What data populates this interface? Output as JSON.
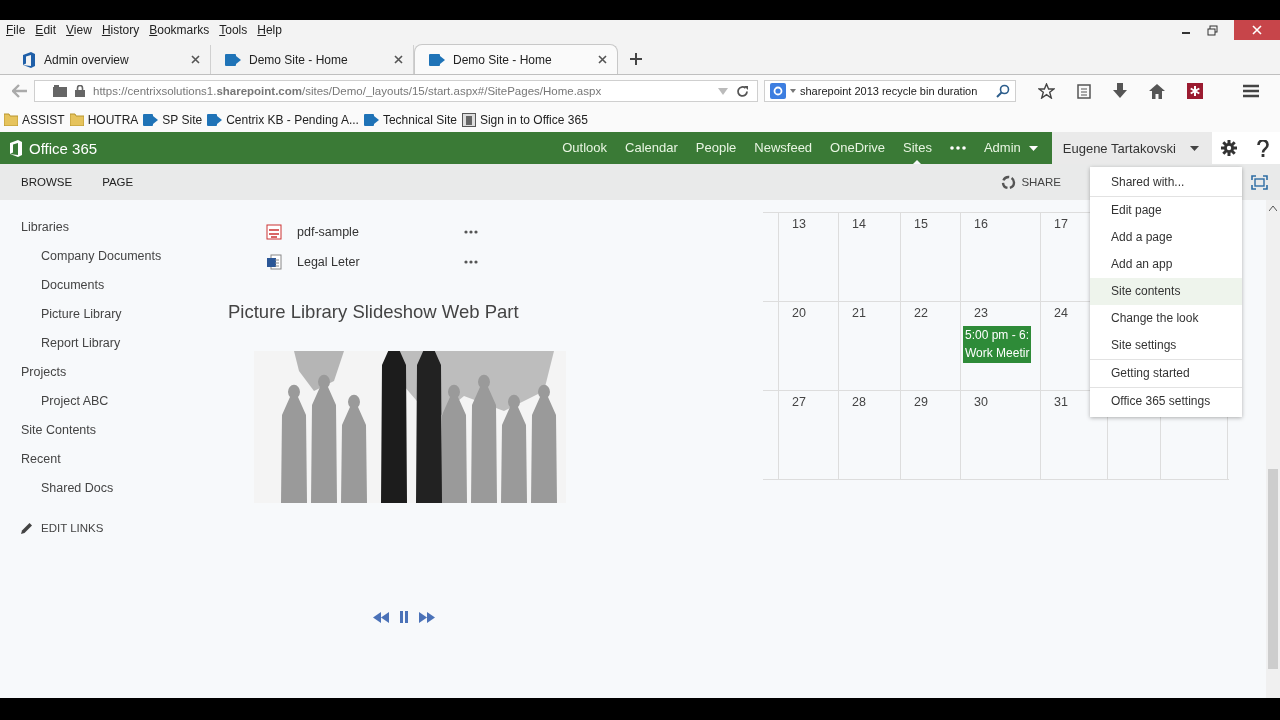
{
  "menu_bar": [
    "File",
    "Edit",
    "View",
    "History",
    "Bookmarks",
    "Tools",
    "Help"
  ],
  "tabs": [
    {
      "label": "Admin overview",
      "kind": "office",
      "selected": false
    },
    {
      "label": "Demo Site - Home",
      "kind": "sharepoint",
      "selected": false
    },
    {
      "label": "Demo Site - Home",
      "kind": "sharepoint",
      "selected": true
    }
  ],
  "address_bar": {
    "url": "https://centrixsolutions1.**sharepoint.com**/sites/Demo/_layouts/15/start.aspx#/SitePages/Home.aspx"
  },
  "search": {
    "value": "sharepoint 2013 recycle bin duration"
  },
  "bookmarks": [
    {
      "label": "ASSIST",
      "kind": "folder"
    },
    {
      "label": "HOUTRA",
      "kind": "folder"
    },
    {
      "label": "SP Site",
      "kind": "sharepoint"
    },
    {
      "label": "Centrix KB - Pending A...",
      "kind": "sharepoint"
    },
    {
      "label": "Technical Site",
      "kind": "sharepoint"
    },
    {
      "label": "Sign in to Office 365",
      "kind": "page"
    }
  ],
  "suite_bar": {
    "brand": "Office 365",
    "links": [
      {
        "label": "Outlook",
        "selected": false
      },
      {
        "label": "Calendar",
        "selected": false
      },
      {
        "label": "People",
        "selected": false
      },
      {
        "label": "Newsfeed",
        "selected": false
      },
      {
        "label": "OneDrive",
        "selected": false
      },
      {
        "label": "Sites",
        "selected": true
      }
    ],
    "admin": "Admin",
    "user": "Eugene Tartakovski"
  },
  "ribbon": {
    "tabs": [
      "BROWSE",
      "PAGE"
    ],
    "share": "SHARE"
  },
  "quick_launch": [
    {
      "label": "Libraries",
      "children": [
        {
          "label": "Company Documents"
        },
        {
          "label": "Documents"
        },
        {
          "label": "Picture Library"
        },
        {
          "label": "Report Library"
        }
      ]
    },
    {
      "label": "Projects",
      "children": [
        {
          "label": "Project ABC"
        }
      ]
    },
    {
      "label": "Site Contents"
    },
    {
      "label": "Recent",
      "children": [
        {
          "label": "Shared Docs"
        }
      ]
    }
  ],
  "edit_links": "EDIT LINKS",
  "documents": [
    {
      "name": "pdf-sample",
      "kind": "pdf"
    },
    {
      "name": "Legal Leter",
      "kind": "word"
    }
  ],
  "slideshow": {
    "title": "Picture Library Slideshow Web Part",
    "kind": "picture"
  },
  "calendar": {
    "weeks": [
      {
        "days": [
          {
            "label": "13"
          },
          {
            "label": "14"
          },
          {
            "label": "15"
          },
          {
            "label": "16"
          },
          {
            "label": "17"
          }
        ]
      },
      {
        "days": [
          {
            "label": "20"
          },
          {
            "label": "21"
          },
          {
            "label": "22"
          },
          {
            "label": "23",
            "events": [
              {
                "time": "5:00 pm - 6:",
                "title": "Work Meetir"
              }
            ]
          },
          {
            "label": "24"
          }
        ]
      },
      {
        "days": [
          {
            "label": "27"
          },
          {
            "label": "28"
          },
          {
            "label": "29"
          },
          {
            "label": "30"
          },
          {
            "label": "31"
          }
        ]
      }
    ]
  },
  "settings_menu": {
    "groups": [
      {
        "items": [
          {
            "label": "Shared with...",
            "selected": false
          }
        ]
      },
      {
        "items": [
          {
            "label": "Edit page",
            "selected": false
          },
          {
            "label": "Add a page",
            "selected": false
          },
          {
            "label": "Add an app",
            "selected": false
          },
          {
            "label": "Site contents",
            "selected": true
          },
          {
            "label": "Change the look",
            "selected": false
          },
          {
            "label": "Site settings",
            "selected": false
          }
        ]
      },
      {
        "items": [
          {
            "label": "Getting started",
            "selected": false
          }
        ]
      },
      {
        "items": [
          {
            "label": "Office 365 settings",
            "selected": false
          }
        ]
      }
    ]
  }
}
